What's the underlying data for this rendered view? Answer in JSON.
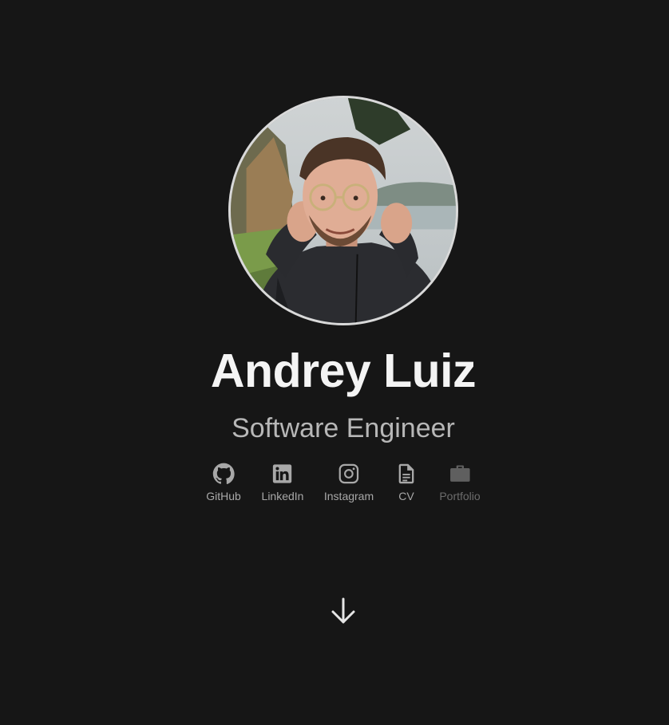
{
  "profile": {
    "name": "Andrey Luiz",
    "title": "Software Engineer"
  },
  "links": [
    {
      "label": "GitHub",
      "icon": "github-icon"
    },
    {
      "label": "LinkedIn",
      "icon": "linkedin-icon"
    },
    {
      "label": "Instagram",
      "icon": "instagram-icon"
    },
    {
      "label": "CV",
      "icon": "document-icon"
    },
    {
      "label": "Portfolio",
      "icon": "briefcase-icon",
      "dimmed": true
    }
  ],
  "scroll": {
    "icon": "arrow-down-icon"
  },
  "colors": {
    "background": "#161616",
    "name": "#f4f4f4",
    "subtitle": "#b7b7b7",
    "link": "#a8a8a8",
    "link_dimmed": "#6c6c6c",
    "avatar_border": "#d9d9d9"
  }
}
